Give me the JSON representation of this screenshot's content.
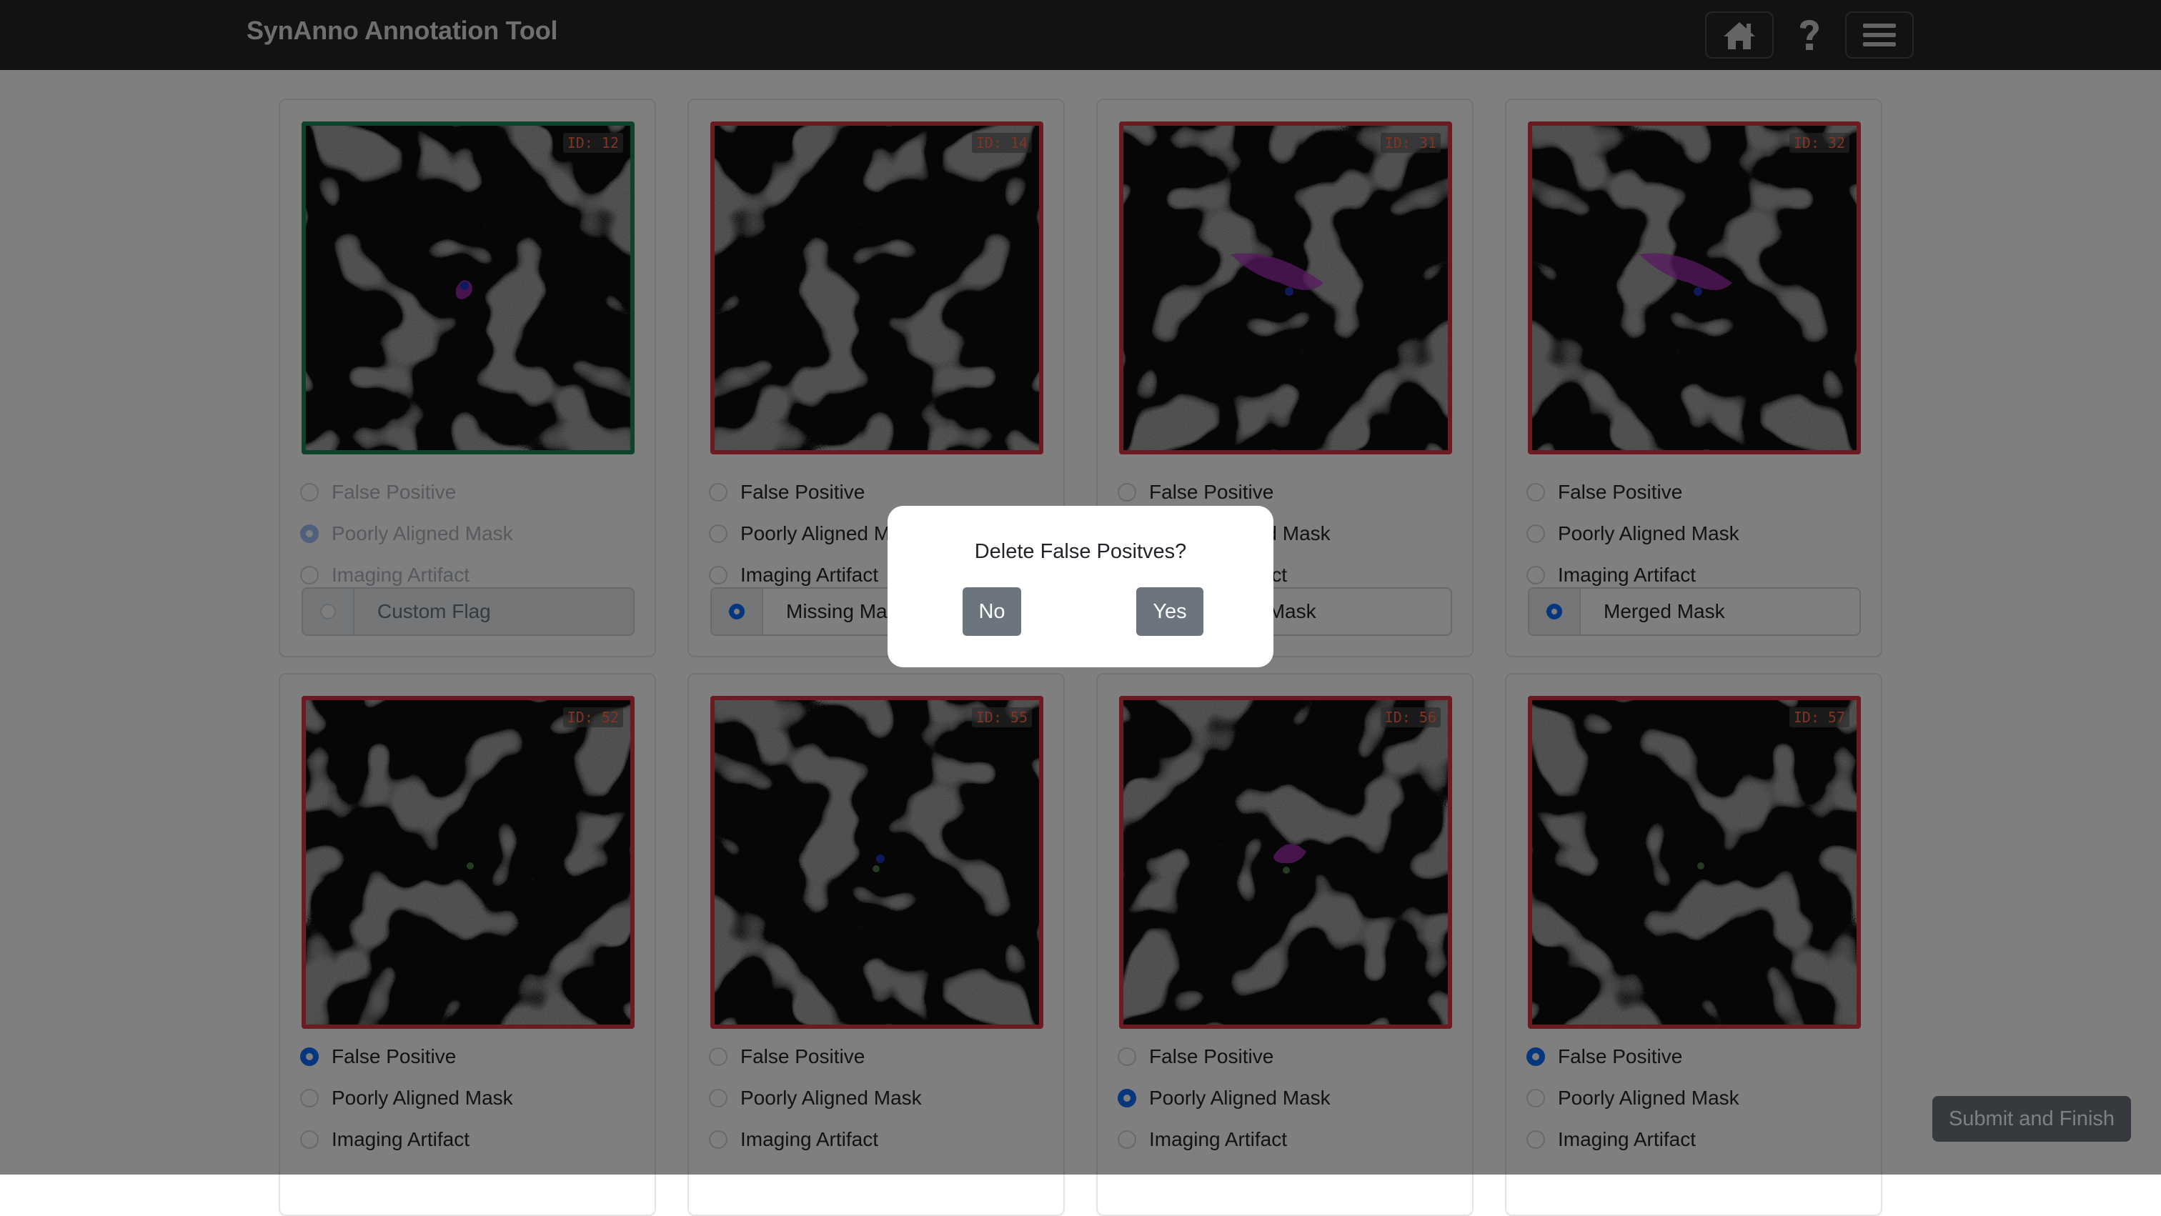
{
  "app": {
    "title": "SynAnno Annotation Tool"
  },
  "nav": {
    "home_icon": "home-icon",
    "help_icon": "question-icon",
    "menu_icon": "hamburger-menu-icon"
  },
  "options": {
    "false_positive": "False Positive",
    "poorly_aligned": "Poorly Aligned Mask",
    "imaging_artifact": "Imaging Artifact"
  },
  "cards": [
    {
      "id": "ID: 12",
      "selected": "poorly_aligned",
      "flag": "Custom Flag",
      "flag_checked": false,
      "status": "correct",
      "disabled": true
    },
    {
      "id": "ID: 14",
      "selected": null,
      "flag": "Missing Mask",
      "flag_checked": true,
      "status": "incorrect"
    },
    {
      "id": "ID: 31",
      "selected": null,
      "flag": "Missing Mask",
      "flag_checked": false,
      "status": "incorrect"
    },
    {
      "id": "ID: 32",
      "selected": null,
      "flag": "Merged Mask",
      "flag_checked": true,
      "status": "incorrect"
    },
    {
      "id": "ID: 52",
      "selected": "false_positive",
      "status": "incorrect"
    },
    {
      "id": "ID: 55",
      "selected": null,
      "status": "incorrect"
    },
    {
      "id": "ID: 56",
      "selected": "poorly_aligned",
      "status": "incorrect"
    },
    {
      "id": "ID: 57",
      "selected": "false_positive",
      "status": "incorrect"
    }
  ],
  "submit": {
    "label": "Submit and Finish"
  },
  "modal": {
    "question": "Delete False Positves?",
    "no_label": "No",
    "yes_label": "Yes"
  },
  "colors": {
    "incorrect_border": "#dc3545",
    "correct_border": "#198754",
    "accent": "#0d6efd",
    "mask": "#b030c0"
  }
}
